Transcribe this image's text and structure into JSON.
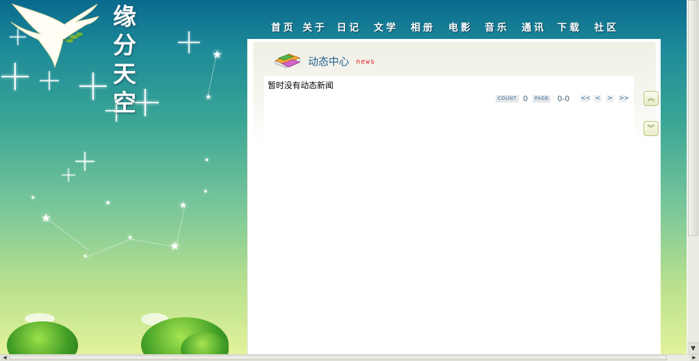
{
  "site": {
    "title": "缘分天空"
  },
  "nav": {
    "items": [
      {
        "label": "首页"
      },
      {
        "label": "关于"
      },
      {
        "label": "日记"
      },
      {
        "label": "文学"
      },
      {
        "label": "相册"
      },
      {
        "label": "电影"
      },
      {
        "label": "音乐"
      },
      {
        "label": "通讯"
      },
      {
        "label": "下载"
      },
      {
        "label": "社区"
      }
    ]
  },
  "section": {
    "title": "动态中心",
    "tag": "news",
    "empty_message": "暂时没有动态新闻"
  },
  "pager": {
    "count_label": "COUNT",
    "count_value": "0",
    "page_label": "PAGE",
    "page_value": "0-0",
    "first": "<<",
    "prev": "<",
    "next": ">",
    "last": ">>"
  },
  "colors": {
    "sky_top": "#0a6a8e",
    "sky_bottom": "#e2f29a",
    "section_title": "#1d5f8c",
    "tag": "#e02020"
  }
}
